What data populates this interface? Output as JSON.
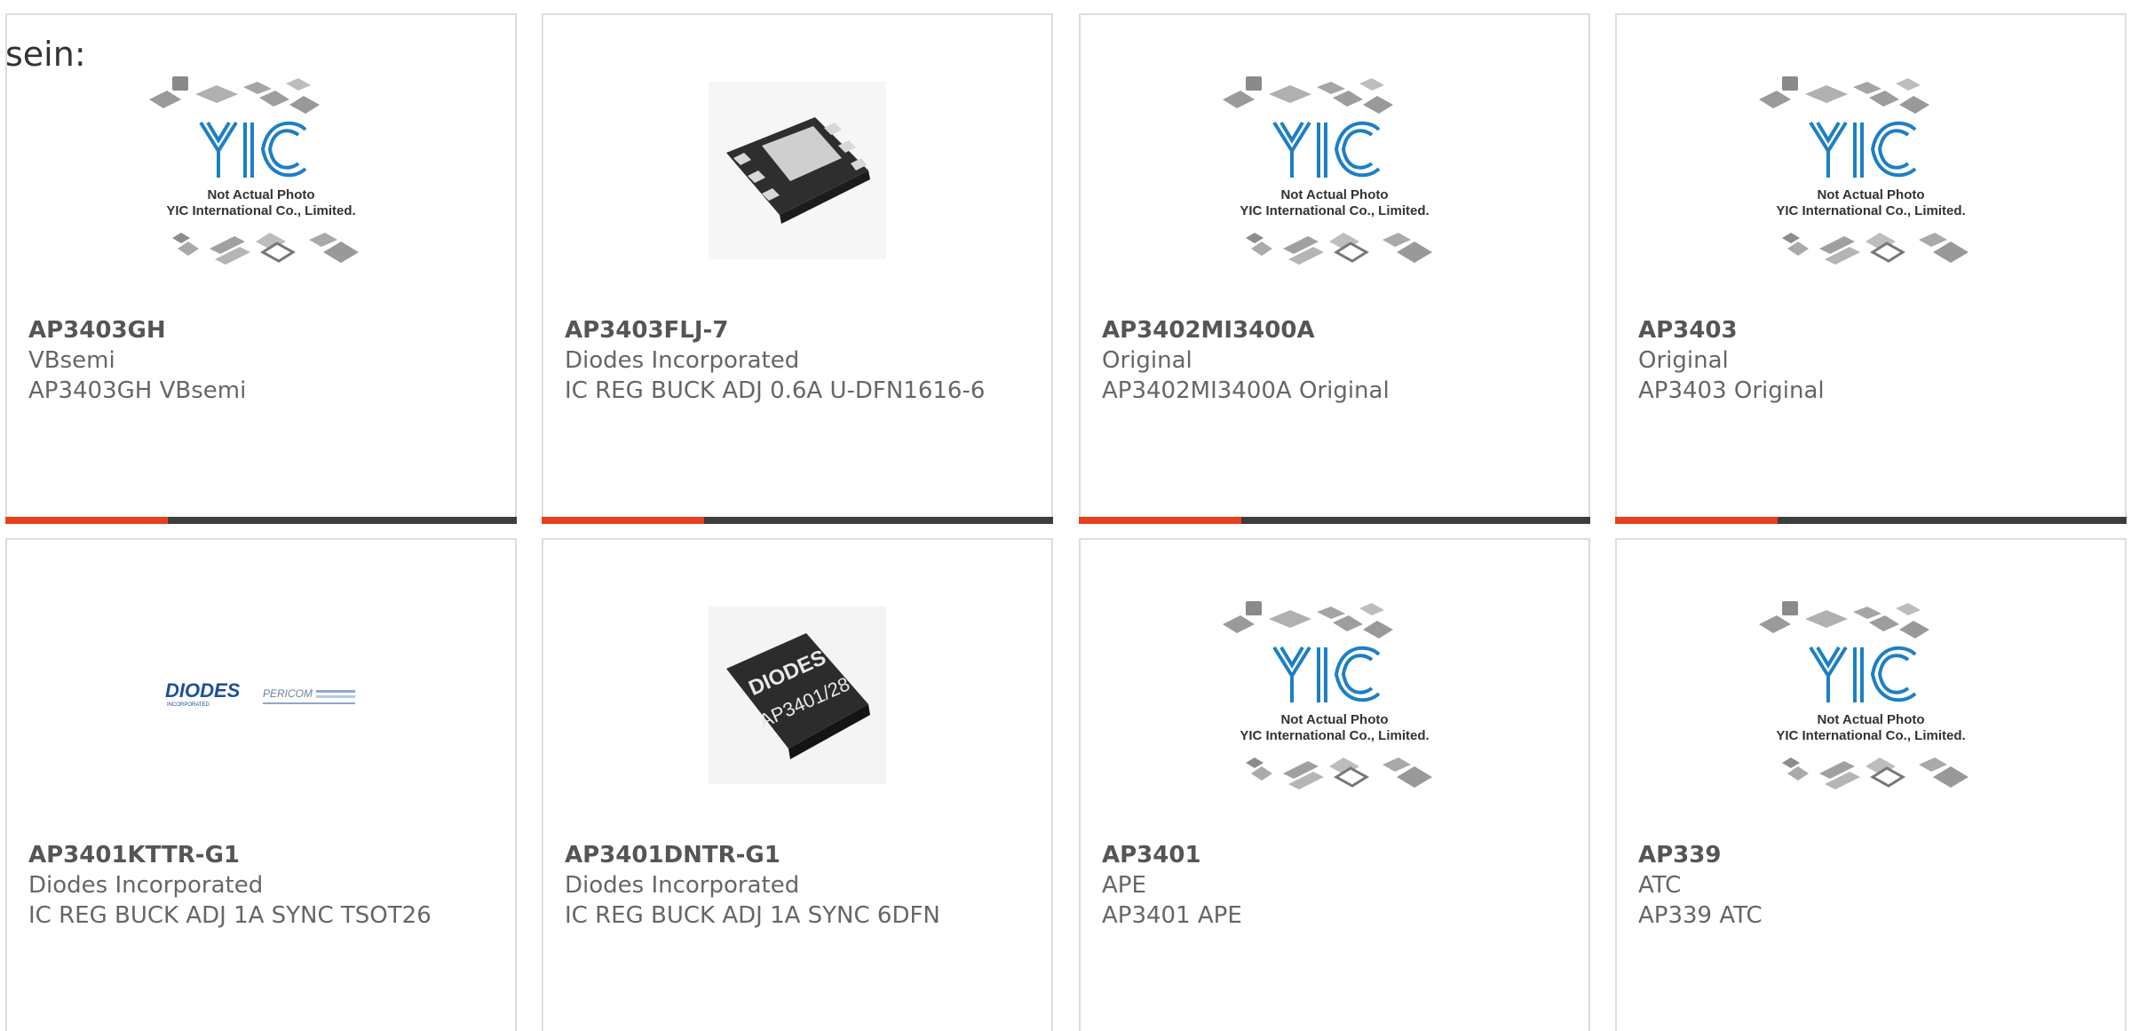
{
  "heading": "sein:",
  "placeholder": {
    "line1": "Not Actual Photo",
    "line2": "YIC International Co., Limited."
  },
  "brand_logos": {
    "diodes": "DIODES",
    "diodes_sub": "INCORPORATED",
    "pericom": "PERICOM",
    "chip_marking_top": "DIODES",
    "chip_marking_bottom": "AP3401/28"
  },
  "colors": {
    "accent": "#e8401c",
    "bar_dark": "#3d3d3d",
    "yic_blue": "#1d7fc4",
    "text": "#666666"
  },
  "products": [
    {
      "part": "AP3403GH",
      "manufacturer": "VBsemi",
      "description": "AP3403GH VBsemi",
      "image": "yic-placeholder"
    },
    {
      "part": "AP3403FLJ-7",
      "manufacturer": "Diodes Incorporated",
      "description": "IC REG BUCK ADJ 0.6A U-DFN1616-6",
      "image": "dfn-chip"
    },
    {
      "part": "AP3402MI3400A",
      "manufacturer": "Original",
      "description": "AP3402MI3400A Original",
      "image": "yic-placeholder"
    },
    {
      "part": "AP3403",
      "manufacturer": "Original",
      "description": "AP3403 Original",
      "image": "yic-placeholder"
    },
    {
      "part": "AP3401KTTR-G1",
      "manufacturer": "Diodes Incorporated",
      "description": "IC REG BUCK ADJ 1A SYNC TSOT26",
      "image": "diodes-logo"
    },
    {
      "part": "AP3401DNTR-G1",
      "manufacturer": "Diodes Incorporated",
      "description": "IC REG BUCK ADJ 1A SYNC 6DFN",
      "image": "marked-chip"
    },
    {
      "part": "AP3401",
      "manufacturer": "APE",
      "description": "AP3401 APE",
      "image": "yic-placeholder"
    },
    {
      "part": "AP339",
      "manufacturer": "ATC",
      "description": "AP339 ATC",
      "image": "yic-placeholder"
    }
  ]
}
